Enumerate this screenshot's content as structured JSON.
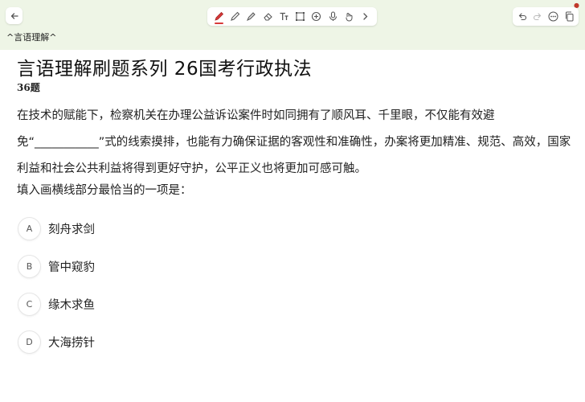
{
  "header": {
    "tab_title": "^言语理解^",
    "toolbar_icons": [
      "pen-icon",
      "pencil-icon",
      "highlighter-icon",
      "eraser-icon",
      "text-icon",
      "lasso-icon",
      "add-shape-icon",
      "microphone-icon",
      "touch-icon",
      "chevron-right-icon"
    ],
    "action_icons": [
      "undo-icon",
      "redo-icon",
      "more-icon",
      "copy-icon"
    ],
    "accent_color": "#d83a3a",
    "toolbar_bg": "#eef5e6"
  },
  "question": {
    "title": "言语理解刷题系列  26国考行政执法",
    "number": "36题",
    "stem": "在技术的赋能下，检察机关在办理公益诉讼案件时如同拥有了顺风耳、千里眼，不仅能有效避免“___________”式的线索摸排，也能有力确保证据的客观性和准确性，办案将更加精准、规范、高效，国家利益和社会公共利益将得到更好守护，公平正义也将更加可感可触。",
    "prompt": "填入画横线部分最恰当的一项是：",
    "options": [
      {
        "letter": "A",
        "text": "刻舟求剑"
      },
      {
        "letter": "B",
        "text": "管中窥豹"
      },
      {
        "letter": "C",
        "text": "缘木求鱼"
      },
      {
        "letter": "D",
        "text": "大海捞针"
      }
    ]
  }
}
